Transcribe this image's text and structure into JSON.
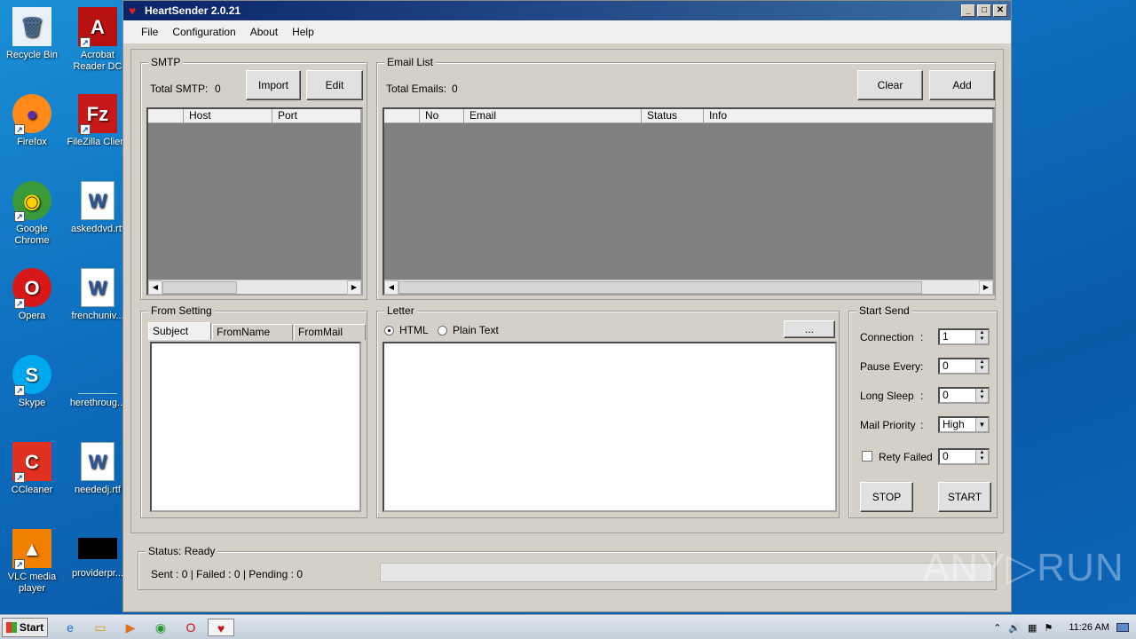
{
  "desktop": {
    "icons": [
      {
        "label": "Recycle Bin",
        "icon": "recycle-bin-icon",
        "glyph": "🗑"
      },
      {
        "label": "Acrobat Reader DC",
        "icon": "acrobat-icon",
        "glyph": "A"
      },
      {
        "label": "Firefox",
        "icon": "firefox-icon",
        "glyph": "●"
      },
      {
        "label": "FileZilla Client",
        "icon": "filezilla-icon",
        "glyph": "Fz"
      },
      {
        "label": "Google Chrome",
        "icon": "chrome-icon",
        "glyph": "◉"
      },
      {
        "label": "askeddvd.rtf",
        "icon": "word-doc-icon",
        "glyph": "W"
      },
      {
        "label": "Opera",
        "icon": "opera-icon",
        "glyph": "O"
      },
      {
        "label": "frenchuniv...",
        "icon": "word-doc-icon",
        "glyph": "W"
      },
      {
        "label": "Skype",
        "icon": "skype-icon",
        "glyph": "S"
      },
      {
        "label": "herethroug...",
        "icon": "blank-file-icon",
        "glyph": ""
      },
      {
        "label": "CCleaner",
        "icon": "ccleaner-icon",
        "glyph": "C"
      },
      {
        "label": "neededj.rtf",
        "icon": "word-doc-icon",
        "glyph": "W"
      },
      {
        "label": "VLC media player",
        "icon": "vlc-icon",
        "glyph": "▲"
      },
      {
        "label": "providerpr...",
        "icon": "black-file-icon",
        "glyph": ""
      }
    ]
  },
  "window": {
    "title": "HeartSender 2.0.21",
    "menu": [
      "File",
      "Configuration",
      "About",
      "Help"
    ]
  },
  "smtp": {
    "title": "SMTP",
    "total_label": "Total SMTP:",
    "total_value": "0",
    "import_label": "Import",
    "edit_label": "Edit",
    "columns": [
      "",
      "Host",
      "Port"
    ]
  },
  "email_list": {
    "title": "Email List",
    "total_label": "Total Emails:",
    "total_value": "0",
    "clear_label": "Clear",
    "add_label": "Add",
    "columns": [
      "",
      "No",
      "Email",
      "Status",
      "Info"
    ]
  },
  "from_setting": {
    "title": "From Setting",
    "tabs": [
      "Subject List",
      "FromName List",
      "FromMail List"
    ]
  },
  "letter": {
    "title": "Letter",
    "html_label": "HTML",
    "plain_label": "Plain Text",
    "browse_label": "..."
  },
  "start_send": {
    "title": "Start Send",
    "connection_label": "Connection",
    "connection_value": "1",
    "pause_label": "Pause Every",
    "pause_value": "0",
    "sleep_label": "Long Sleep",
    "sleep_value": "0",
    "priority_label": "Mail Priority",
    "priority_value": "High",
    "retry_label": "Rety Failed",
    "retry_value": "0",
    "colon": ":",
    "stop_label": "STOP",
    "start_label": "START"
  },
  "status": {
    "title": "Status: Ready",
    "counts": "Sent : 0 | Failed : 0 | Pending : 0"
  },
  "taskbar": {
    "start_label": "Start",
    "clock": "11:26 AM"
  },
  "watermark": "ANY▷RUN"
}
